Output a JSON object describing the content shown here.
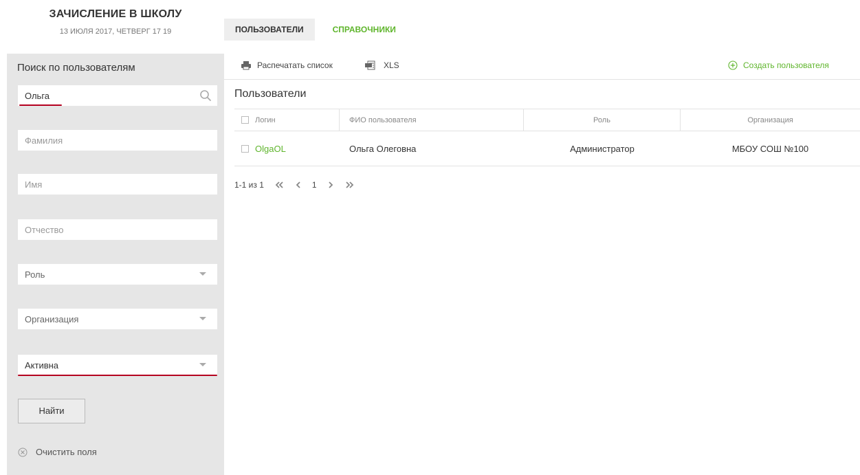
{
  "header": {
    "title": "ЗАЧИСЛЕНИЕ В ШКОЛУ",
    "date": "13 ИЮЛЯ 2017, ЧЕТВЕРГ 17 19",
    "tabs": [
      {
        "label": "ПОЛЬЗОВАТЕЛИ",
        "active": true
      },
      {
        "label": "СПРАВОЧНИКИ",
        "active": false
      }
    ]
  },
  "sidebar": {
    "title": "Поиск по пользователям",
    "search_value": "Ольга",
    "lastname_placeholder": "Фамилия",
    "firstname_placeholder": "Имя",
    "patronymic_placeholder": "Отчество",
    "role_select": "Роль",
    "org_select": "Организация",
    "status_select": "Активна",
    "find_button": "Найти",
    "clear_label": "Очистить поля"
  },
  "toolbar": {
    "print_label": "Распечатать список",
    "xls_label": "XLS",
    "create_label": "Создать пользователя"
  },
  "main": {
    "title": "Пользователи",
    "columns": [
      "Логин",
      "ФИО пользователя",
      "Роль",
      "Организация"
    ],
    "rows": [
      {
        "login": "OlgaOL",
        "fio": "Ольга Олеговна",
        "role": "Администратор",
        "org": "МБОУ СОШ №100"
      }
    ]
  },
  "pagination": {
    "range": "1-1 из 1",
    "current_page": "1"
  },
  "colors": {
    "accent_green": "#5fb52c",
    "annotation_red": "#b5001f",
    "sidebar_bg": "#e6e6e6"
  }
}
